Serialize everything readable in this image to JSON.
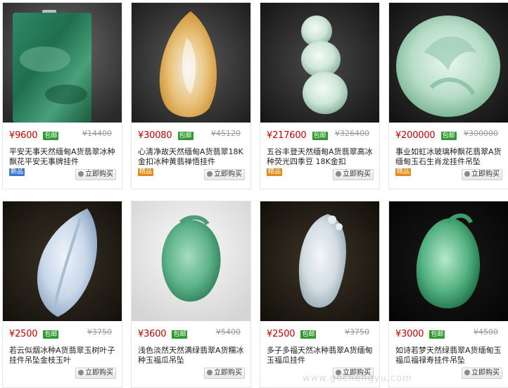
{
  "products": [
    {
      "price": "¥9600",
      "shipping": "包邮",
      "original_price": "¥14400",
      "title": "平安无事天然缅甸A货翡翠冰种飘花平安无事牌挂件",
      "tag": "新品",
      "tag_kind": "new",
      "buy_label": "立即购买",
      "image": "green-floating-flower-plaque"
    },
    {
      "price": "¥30080",
      "shipping": "包邮",
      "original_price": "¥45120",
      "title": "心清净故天然缅甸A货翡翠18K金扣冰种黄翡禅悟挂件",
      "tag": "精品",
      "tag_kind": "best",
      "buy_label": "立即购买",
      "image": "yellow-jadeite-zen-pendant"
    },
    {
      "price": "¥217600",
      "shipping": "包邮",
      "original_price": "¥326400",
      "title": "五谷丰登天然缅甸A货翡翠高冰种荧光四季豆 18K金扣",
      "tag": "精品",
      "tag_kind": "best",
      "buy_label": "立即购买",
      "image": "ice-jadeite-pea-pod"
    },
    {
      "price": "¥200000",
      "shipping": "包邮",
      "original_price": "¥300000",
      "title": "事业如虹冰玻璃种飘花翡翠A货缅甸玉石生肖龙挂件吊坠",
      "tag": "精品",
      "tag_kind": "best",
      "buy_label": "立即购买",
      "image": "glass-jadeite-dragon"
    },
    {
      "price": "¥2500",
      "shipping": "包邮",
      "original_price": "¥3750",
      "title": "若云似烟冰种A货翡翠玉树叶子挂件吊坠金枝玉叶",
      "tag": "",
      "tag_kind": "",
      "buy_label": "立即购买",
      "image": "ice-jadeite-leaf"
    },
    {
      "price": "¥3600",
      "shipping": "包邮",
      "original_price": "¥5400",
      "title": "浅色淡然天然满绿翡翠A货糯冰种玉福瓜吊坠",
      "tag": "",
      "tag_kind": "",
      "buy_label": "立即购买",
      "image": "green-jadeite-gourd"
    },
    {
      "price": "¥2500",
      "shipping": "包邮",
      "original_price": "¥3750",
      "title": "多子多福天然冰种翡翠A货缅甸玉福瓜挂件",
      "tag": "",
      "tag_kind": "",
      "buy_label": "立即购买",
      "image": "ice-jadeite-gourd"
    },
    {
      "price": "¥3000",
      "shipping": "包邮",
      "original_price": "¥4500",
      "title": "如诗若梦天然绿翡翠A货缅甸玉福瓜福禄寿挂件吊坠",
      "tag": "",
      "tag_kind": "",
      "buy_label": "立即购买",
      "image": "green-jadeite-fortune-gourd"
    }
  ],
  "watermark": "www.gochengyu.com",
  "colors": {
    "price": "#c40000",
    "shipping_badge": "#2f9a2f",
    "tag_new": "#3b79cc",
    "tag_best": "#e28b1d"
  }
}
